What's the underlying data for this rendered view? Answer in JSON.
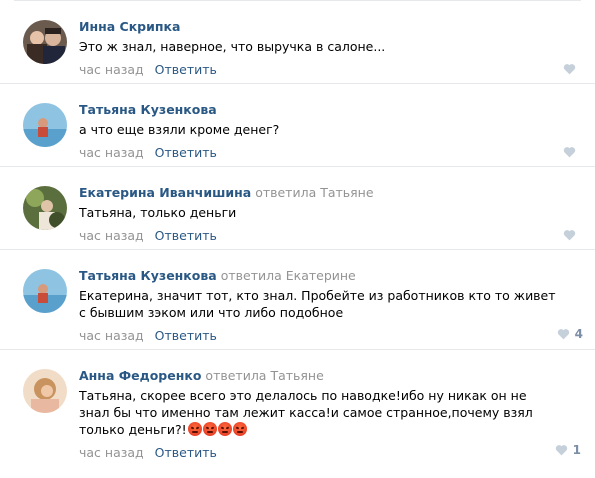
{
  "comments": [
    {
      "author": "Инна Скрипка",
      "replied_label": "",
      "replied_to": "",
      "text": "Это ж знал, наверное, что выручка в салоне...",
      "time": "час назад",
      "reply": "Ответить",
      "likes": ""
    },
    {
      "author": "Татьяна Кузенкова",
      "replied_label": "",
      "replied_to": "",
      "text": "а что еще взяли кроме денег?",
      "time": "час назад",
      "reply": "Ответить",
      "likes": ""
    },
    {
      "author": "Екатерина Иванчишина",
      "replied_label": "ответила",
      "replied_to": "Татьяне",
      "text": "Татьяна, только деньги",
      "time": "час назад",
      "reply": "Ответить",
      "likes": ""
    },
    {
      "author": "Татьяна Кузенкова",
      "replied_label": "ответила",
      "replied_to": "Екатерине",
      "text": "Екатерина, значит тот, кто знал. Пробейте из работников кто то живет с бывшим зэком или что либо подобное",
      "time": "час назад",
      "reply": "Ответить",
      "likes": "4"
    },
    {
      "author": "Анна Федоренко",
      "replied_label": "ответила",
      "replied_to": "Татьяне",
      "text": "Татьяна, скорее всего это делалось по наводке!ибо ну никак он не знал бы что именно там лежит касса!и самое странное,почему взял только деньги?!",
      "time": "час назад",
      "reply": "Ответить",
      "likes": "1"
    }
  ],
  "colors": {
    "link": "#2a5885",
    "muted": "#939393",
    "like_icon": "#c5d0db",
    "divider": "#e7e8ec"
  },
  "icons": {
    "like": "heart-icon",
    "emoji": "angry-face-emoji"
  }
}
